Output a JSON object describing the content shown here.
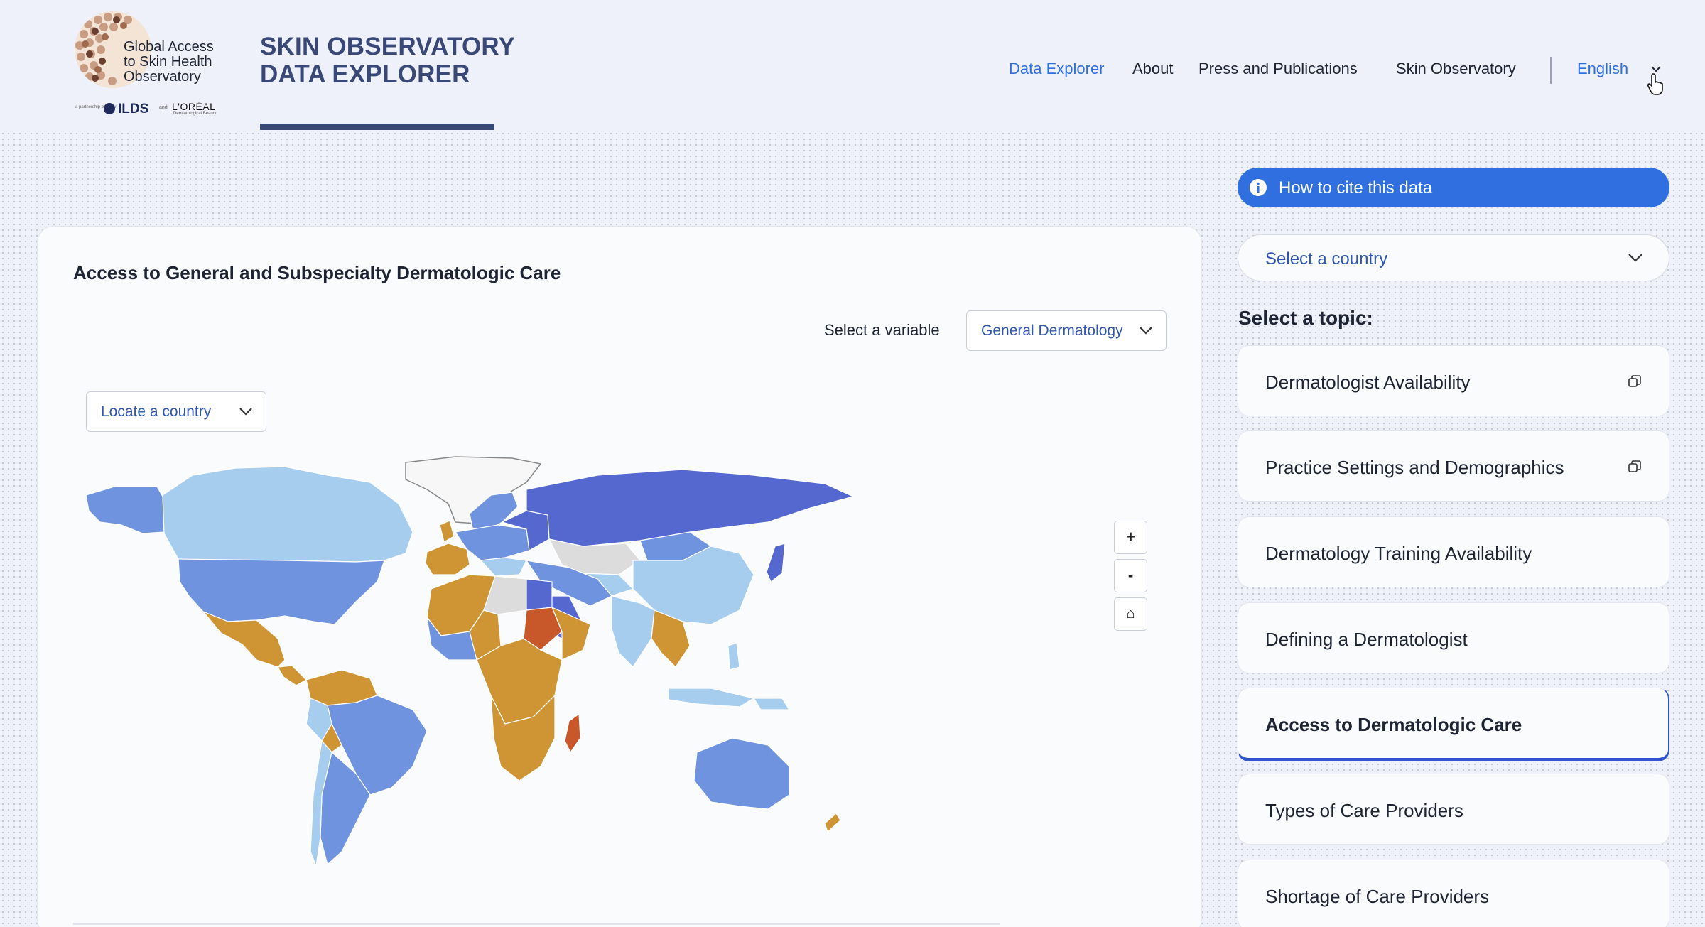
{
  "logo": {
    "lines": [
      "Global Access",
      "to Skin Health",
      "Observatory"
    ],
    "partners_small": "a partnership between",
    "ilds": "ILDS",
    "amp": "and",
    "loreal": "L'ORÉAL",
    "loreal_sub": "Dermatological Beauty"
  },
  "site_title": {
    "line1": "SKIN OBSERVATORY",
    "line2": "DATA EXPLORER"
  },
  "nav": {
    "items": [
      {
        "label": "Data Explorer",
        "active": true
      },
      {
        "label": "About"
      },
      {
        "label": "Press and Publications"
      },
      {
        "label": "Skin Observatory"
      }
    ],
    "language": "English"
  },
  "card": {
    "title": "Access to General and Subspecialty Dermatologic Care",
    "variable_label": "Select a variable",
    "variable_value": "General Dermatology",
    "locate_placeholder": "Locate a country",
    "zoom_in": "+",
    "zoom_out": "-",
    "home": "⌂"
  },
  "map_legend_colors": {
    "dark_blue": "#5468cf",
    "blue": "#6f93de",
    "light_blue": "#a7cdee",
    "gold": "#cf9535",
    "red_orange": "#c8572a",
    "no_data": "#dcdcdc"
  },
  "sidebar": {
    "cite_label": "How to cite this data",
    "country_placeholder": "Select a country",
    "topic_heading": "Select a topic:",
    "topics": [
      {
        "label": "Dermatologist Availability",
        "copy": true
      },
      {
        "label": "Practice Settings and Demographics",
        "copy": true
      },
      {
        "label": "Dermatology Training Availability"
      },
      {
        "label": "Defining a Dermatologist"
      },
      {
        "label": "Access to Dermatologic Care",
        "active": true
      },
      {
        "label": "Types of Care Providers"
      },
      {
        "label": "Shortage of Care Providers"
      }
    ]
  }
}
